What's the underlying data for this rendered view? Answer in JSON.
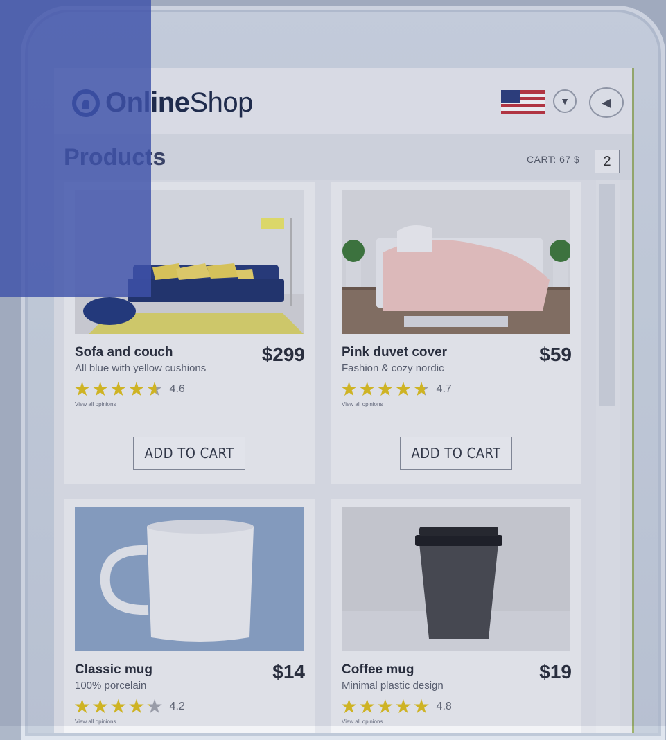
{
  "header": {
    "logo_part1": "On",
    "logo_part2": "line",
    "logo_part3": "Shop",
    "flag_icon": "us-flag-icon",
    "dropdown_icon": "chevron-down-icon",
    "back_icon": "back-arrow-icon"
  },
  "page": {
    "title": "Products",
    "cart_label": "CART: 67 $",
    "cart_count": "2"
  },
  "products": [
    {
      "name": "Sofa and couch",
      "price": "$299",
      "description": "All blue with yellow cushions",
      "rating": "4.6",
      "rating_value": 4.6,
      "opinions": "View all opinions",
      "button": "ADD TO CART",
      "image": "sofa-image"
    },
    {
      "name": "Pink duvet cover",
      "price": "$59",
      "description": "Fashion & cozy nordic",
      "rating": "4.7",
      "rating_value": 4.7,
      "opinions": "View all opinions",
      "button": "ADD TO CART",
      "image": "bed-image"
    },
    {
      "name": "Classic mug",
      "price": "$14",
      "description": "100% porcelain",
      "rating": "4.2",
      "rating_value": 4.2,
      "opinions": "View all opinions",
      "button": "",
      "image": "mug-image"
    },
    {
      "name": "Coffee mug",
      "price": "$19",
      "description": "Minimal plastic design",
      "rating": "4.8",
      "rating_value": 4.8,
      "opinions": "View all opinions",
      "button": "",
      "image": "coffee-cup-image"
    }
  ],
  "colors": {
    "star": "#e1c21d",
    "brand": "#233a7a",
    "overlay": "#3e52aa"
  }
}
